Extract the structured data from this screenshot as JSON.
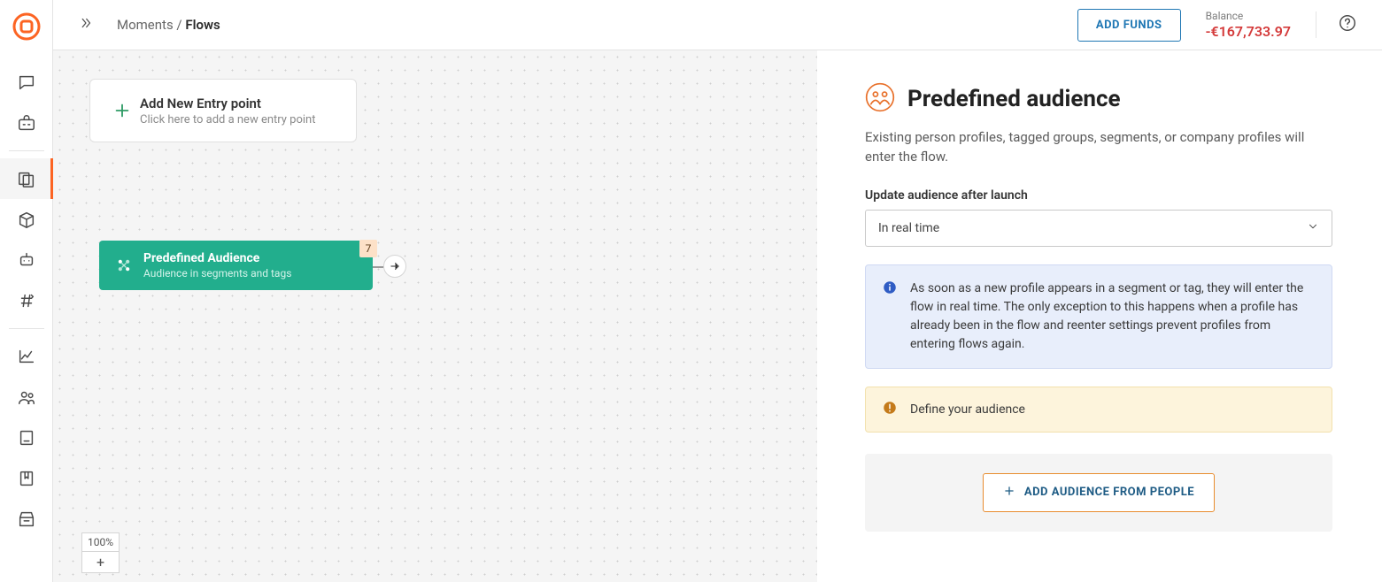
{
  "breadcrumb": {
    "root": "Moments",
    "sep": " / ",
    "current": "Flows"
  },
  "topbar": {
    "add_funds": "ADD FUNDS",
    "balance_label": "Balance",
    "balance_value": "-€167,733.97"
  },
  "canvas": {
    "entry_card": {
      "title": "Add New Entry point",
      "subtitle": "Click here to add a new entry point"
    },
    "audience_node": {
      "title": "Predefined Audience",
      "subtitle": "Audience in segments and tags",
      "badge": "7"
    },
    "zoom": "100%"
  },
  "panel": {
    "title": "Predefined audience",
    "description": "Existing person profiles, tagged groups, segments, or company profiles will enter the flow.",
    "update_label": "Update audience after launch",
    "update_value": "In real time",
    "info": "As soon as a new profile appears in a segment or tag, they will enter the flow in real time. The only exception to this happens when a profile has already been in the flow and reenter settings prevent profiles from entering flows again.",
    "warn": "Define your audience",
    "add_audience_btn": "ADD AUDIENCE FROM PEOPLE"
  }
}
